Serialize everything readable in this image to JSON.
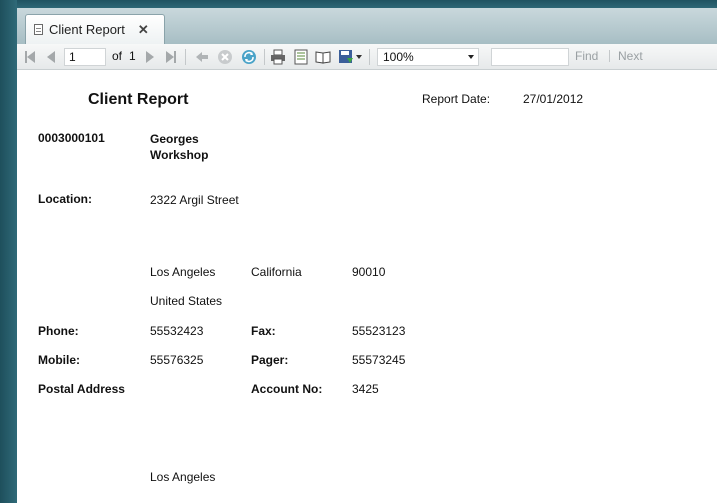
{
  "tab": {
    "title": "Client Report"
  },
  "toolbar": {
    "page_current": "1",
    "of_label": "of",
    "page_total": "1",
    "zoom": "100%",
    "find_label": "Find",
    "next_label": "Next"
  },
  "report": {
    "title": "Client Report",
    "report_date_label": "Report Date:",
    "report_date": "27/01/2012",
    "client_id": "0003000101",
    "client_name": "Georges Workshop",
    "location_label": "Location:",
    "street": "2322 Argil Street",
    "city": "Los Angeles",
    "state": "California",
    "zip": "90010",
    "country": "United States",
    "phone_label": "Phone:",
    "phone": "55532423",
    "fax_label": "Fax:",
    "fax": "55523123",
    "mobile_label": "Mobile:",
    "mobile": "55576325",
    "pager_label": "Pager:",
    "pager": "55573245",
    "postal_label": "Postal Address",
    "account_label": "Account No:",
    "account": "3425",
    "postal_city": "Los Angeles"
  }
}
